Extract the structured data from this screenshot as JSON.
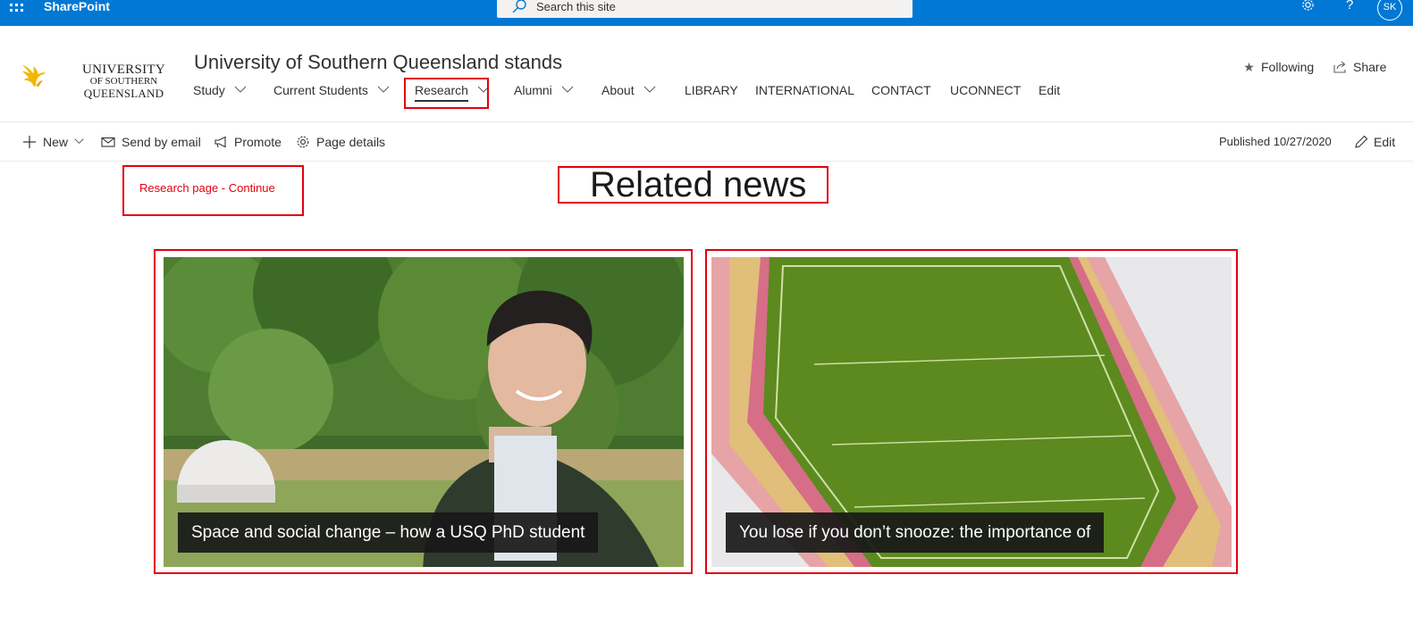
{
  "suite_bar": {
    "app_name": "SharePoint",
    "search_placeholder": "Search this site",
    "settings_icon": "gear-icon",
    "help_glyph": "?",
    "avatar_initials": "SK",
    "color": "#0078d4"
  },
  "site": {
    "logo": {
      "line1": "UNIVERSITY",
      "line2": "OF SOUTHERN",
      "line3": "QUEENSLAND",
      "color": "#f2b705"
    },
    "title": "University of Southern Queensland stands",
    "nav": [
      {
        "label": "Study",
        "has_dropdown": true
      },
      {
        "label": "Current Students",
        "has_dropdown": true
      },
      {
        "label": "Research",
        "has_dropdown": true,
        "active": true
      },
      {
        "label": "Alumni",
        "has_dropdown": true
      },
      {
        "label": "About",
        "has_dropdown": true
      },
      {
        "label": "LIBRARY",
        "has_dropdown": false
      },
      {
        "label": "INTERNATIONAL",
        "has_dropdown": false
      },
      {
        "label": "CONTACT",
        "has_dropdown": false
      },
      {
        "label": "UCONNECT",
        "has_dropdown": false
      },
      {
        "label": "Edit",
        "has_dropdown": false
      }
    ],
    "following_label": "Following",
    "share_label": "Share"
  },
  "command_bar": {
    "new_label": "New",
    "send_email_label": "Send by email",
    "promote_label": "Promote",
    "page_details_label": "Page details",
    "published_text": "Published 10/27/2020",
    "edit_label": "Edit"
  },
  "content": {
    "research_link": "Research page - Continue",
    "heading": "Related news",
    "news": [
      {
        "caption": "Space and social change – how a USQ PhD student",
        "image": "portrait-outdoors"
      },
      {
        "caption": "You lose if you don’t snooze: the importance of",
        "image": "stadium-aerial"
      }
    ]
  },
  "colors": {
    "annotation_red": "#e3000f",
    "caption_bg": "#181818"
  }
}
